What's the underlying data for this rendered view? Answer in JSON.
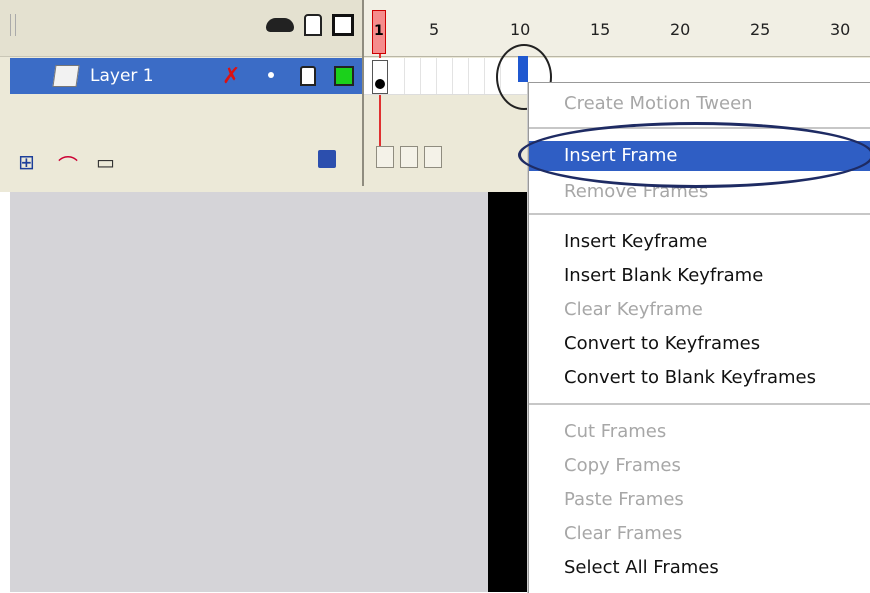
{
  "timeline": {
    "layer_name": "Layer 1",
    "frame_numbers": [
      "1",
      "5",
      "10",
      "15",
      "20",
      "25",
      "30"
    ]
  },
  "context_menu": {
    "items": [
      {
        "label": "Create Motion Tween",
        "disabled": true
      },
      {
        "label": "Insert Frame",
        "highlight": true
      },
      {
        "label": "Remove Frames",
        "disabled": true
      },
      {
        "label": "Insert Keyframe"
      },
      {
        "label": "Insert Blank Keyframe"
      },
      {
        "label": "Clear Keyframe",
        "disabled": true
      },
      {
        "label": "Convert to Keyframes"
      },
      {
        "label": "Convert to Blank Keyframes"
      },
      {
        "label": "Cut Frames",
        "disabled": true
      },
      {
        "label": "Copy Frames",
        "disabled": true
      },
      {
        "label": "Paste Frames",
        "disabled": true
      },
      {
        "label": "Clear Frames",
        "disabled": true
      },
      {
        "label": "Select All Frames"
      }
    ]
  },
  "colors": {
    "selection_blue": "#2f5ec4",
    "layer_row_blue": "#3b6cc6",
    "playhead_red": "#e03030",
    "outline_green": "#1bd11b"
  },
  "icons": [
    "eye-icon",
    "lock-icon",
    "outline-icon",
    "pencil-icon",
    "add-layer-icon",
    "add-guide-icon",
    "add-folder-icon",
    "trash-icon",
    "onion-skin-icon"
  ]
}
